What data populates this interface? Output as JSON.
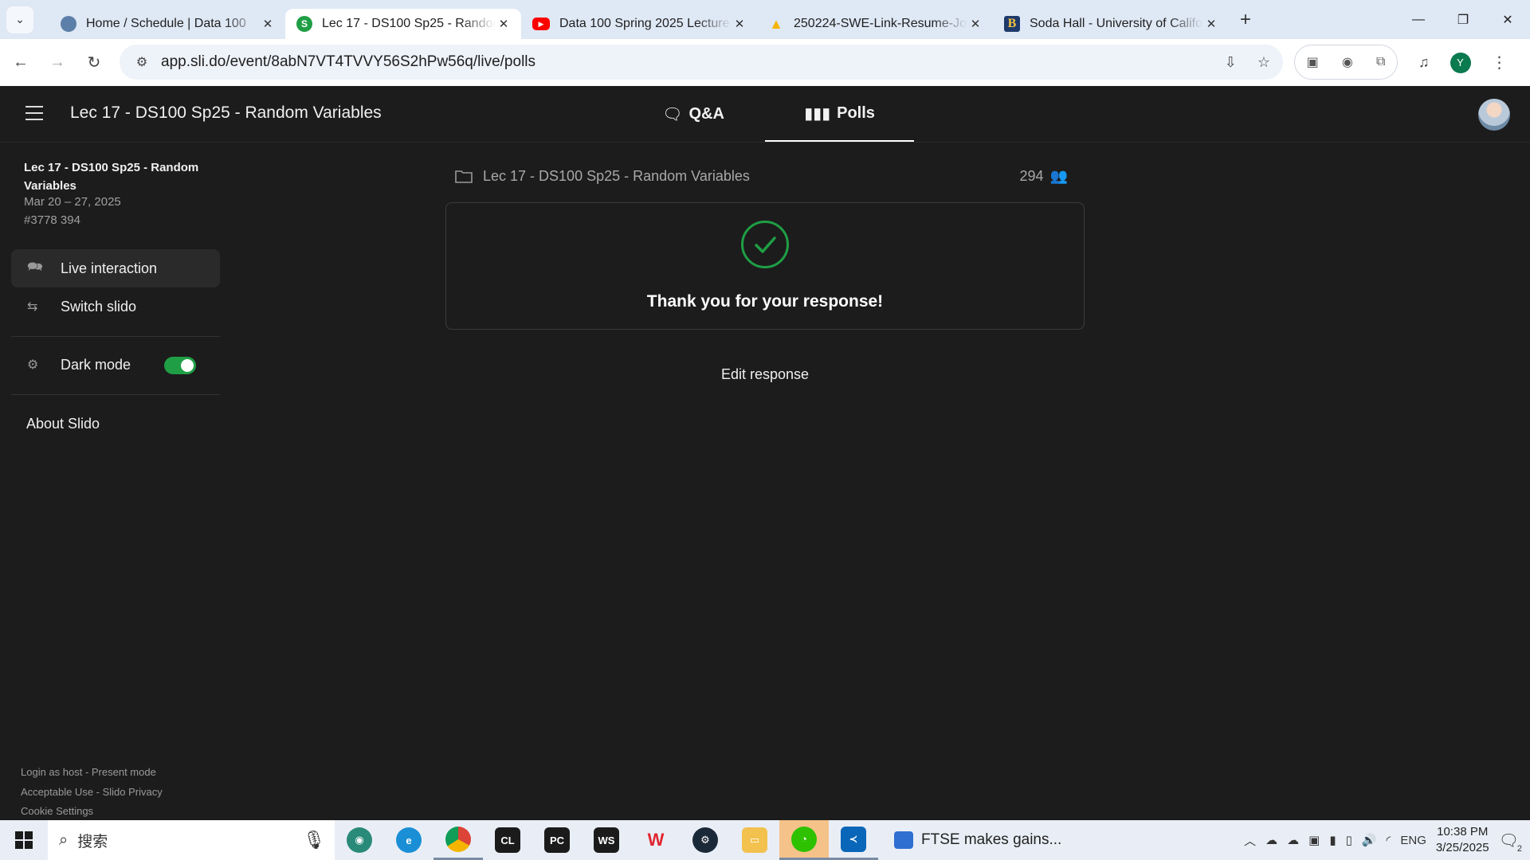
{
  "browser": {
    "tabs": [
      {
        "title": "Home / Schedule | Data 100",
        "fav_color": "#5b7fa8",
        "fav_glyph": ""
      },
      {
        "title": "Lec 17 - DS100 Sp25 - Random Variables",
        "fav_color": "#1f9e45",
        "fav_glyph": "S",
        "active": true
      },
      {
        "title": "Data 100 Spring 2025 Lecture",
        "fav_color": "#ff0000",
        "fav_glyph": "▶"
      },
      {
        "title": "250224-SWE-Link-Resume-Jo",
        "fav_color": "#f4b400",
        "fav_glyph": "▲"
      },
      {
        "title": "Soda Hall - University of California",
        "fav_color": "#1e3a6b",
        "fav_glyph": "B"
      }
    ],
    "url": "app.sli.do/event/8abN7VT4TVVY56S2hPw56q/live/polls",
    "profile_initial": "Y"
  },
  "header": {
    "title": "Lec 17 - DS100 Sp25 - Random Variables",
    "tabs": [
      {
        "label": "Q&A"
      },
      {
        "label": "Polls"
      }
    ]
  },
  "sidebar": {
    "event_title": "Lec 17 - DS100 Sp25 - Random Variables",
    "dates": "Mar 20 – 27, 2025",
    "code": "#3778 394",
    "items": [
      {
        "label": "Live interaction"
      },
      {
        "label": "Switch slido"
      }
    ],
    "dark_mode": {
      "label": "Dark mode",
      "enabled": true
    },
    "about": "About Slido",
    "footer": [
      "Login as host - Present mode",
      "Acceptable Use - Slido Privacy",
      "Cookie Settings"
    ]
  },
  "main": {
    "event_title": "Lec 17 - DS100 Sp25 - Random Variables",
    "participants": "294",
    "thanks": "Thank you for your response!",
    "edit_button": "Edit response"
  },
  "taskbar": {
    "search_placeholder": "搜索",
    "news": "FTSE makes gains...",
    "lang": "ENG",
    "time": "10:38 PM",
    "date": "3/25/2025",
    "notif_count": "2"
  }
}
